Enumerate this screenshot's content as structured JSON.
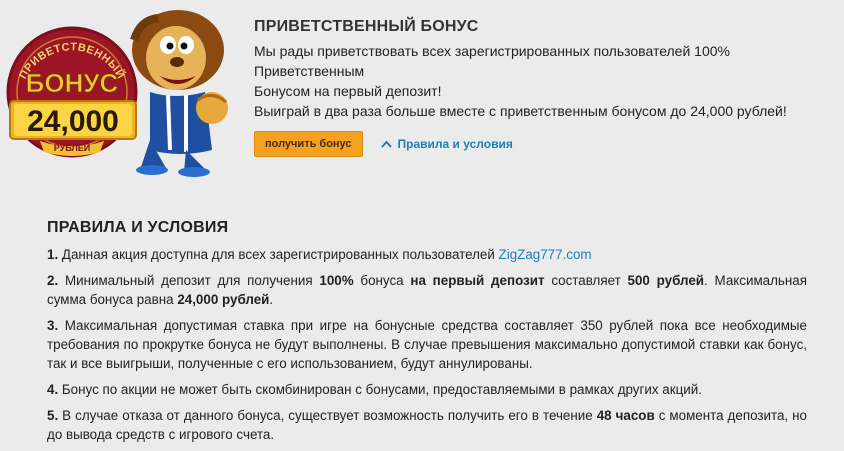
{
  "badge": {
    "arc_text": "ПРИВЕТСТВЕННЫЙ",
    "bonus_word": "БОНУС",
    "amount": "24,000",
    "currency": "РУБЛЕЙ"
  },
  "promo": {
    "title": "ПРИВЕТСТВЕННЫЙ БОНУС",
    "line1": "Мы рады приветствовать всех зарегистрированных пользователей 100% Приветственным",
    "line2": "Бонусом на первый депозит!",
    "line3": "Выиграй в два раза больше вместе с приветственным бонусом до 24,000 рублей!",
    "get_bonus_label": "получить бонус",
    "rules_link_label": "Правила и условия"
  },
  "rules": {
    "heading": "ПРАВИЛА И УСЛОВИЯ",
    "r1": {
      "num": "1.",
      "text": " Данная акция доступна для всех зарегистрированных пользователей ",
      "link": "ZigZag777.com"
    },
    "r2": {
      "num": "2.",
      "t1": " Минимальный депозит для получения ",
      "b1": "100%",
      "t2": " бонуса ",
      "b2": "на первый депозит",
      "t3": " составляет ",
      "b3": "500 рублей",
      "t4": ". Максимальная сумма бонуса равна ",
      "b4": "24,000 рублей",
      "t5": "."
    },
    "r3": {
      "num": "3.",
      "text": " Максимальная допустимая ставка при игре на бонусные средства составляет 350 рублей пока все необходимые требования по прокрутке бонуса не будут выполнены. В случае превышения максимально допустимой ставки как бонус, так и все выигрыши, полученные с его использованием, будут аннулированы."
    },
    "r4": {
      "num": "4.",
      "text": " Бонус по акции не может быть скомбинирован с бонусами, предоставляемыми в рамках других акций."
    },
    "r5": {
      "num": "5.",
      "t1": " В случае отказа от данного бонуса, существует возможность получить его в течение ",
      "b1": "48 часов",
      "t2": " с момента депозита, но до вывода средств с игрового счета."
    }
  },
  "colors": {
    "background": "#ebebeb",
    "button": "#f4a11f",
    "link": "#1e7fb5",
    "badge_red": "#a3172a",
    "badge_gold": "#f2c12e"
  },
  "icons": {
    "rules_link": "chevron-up-icon",
    "mascot": "lion-mascot"
  }
}
